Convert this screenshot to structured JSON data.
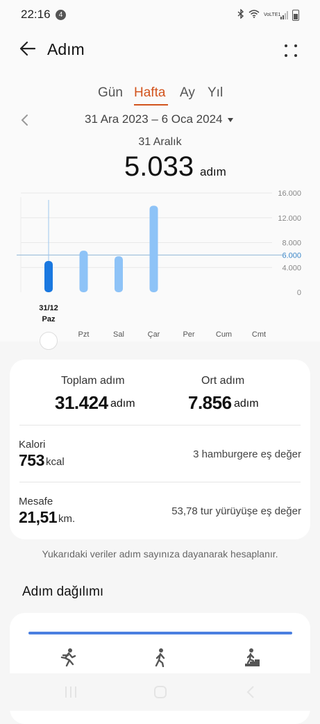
{
  "status": {
    "time": "22:16",
    "notif_count": "4",
    "net_label": "VoLTE1"
  },
  "header": {
    "title": "Adım"
  },
  "tabs": [
    {
      "label": "Gün",
      "active": false
    },
    {
      "label": "Hafta",
      "active": true
    },
    {
      "label": "Ay",
      "active": false
    },
    {
      "label": "Yıl",
      "active": false
    }
  ],
  "date_range": "31 Ara 2023 – 6 Oca 2024",
  "selected": {
    "day": "31 Aralık",
    "value": "5.033",
    "unit": "adım"
  },
  "chart_data": {
    "type": "bar",
    "categories": [
      "Paz",
      "Pzt",
      "Sal",
      "Çar",
      "Per",
      "Cum",
      "Cmt"
    ],
    "selected_date_label": "31/12",
    "values": [
      5033,
      6700,
      5800,
      13950,
      0,
      0,
      0
    ],
    "ylim": [
      0,
      16000
    ],
    "yticks": [
      "16.000",
      "12.000",
      "8.000",
      "6.000",
      "4.000",
      "0"
    ],
    "ytick_values": [
      16000,
      12000,
      8000,
      6000,
      4000,
      0
    ],
    "goal_value": 6000,
    "goal_label": "6.000",
    "selected_index": 0,
    "colors": {
      "bar": "#8ec3f7",
      "selected_bar": "#1a78e0",
      "goal_line": "#8fb6d6",
      "goal_text": "#3a86c8"
    }
  },
  "summary": {
    "total_label": "Toplam adım",
    "total_value": "31.424",
    "total_unit": "adım",
    "avg_label": "Ort adım",
    "avg_value": "7.856",
    "avg_unit": "adım",
    "calorie_label": "Kalori",
    "calorie_value": "753",
    "calorie_unit": "kcal",
    "calorie_equiv": "3 hamburgere eş değer",
    "distance_label": "Mesafe",
    "distance_value": "21,51",
    "distance_unit": "km.",
    "distance_equiv": "53,78 tur yürüyüşe eş değer"
  },
  "note": "Yukarıdaki veriler adım sayınıza dayanarak hesaplanır.",
  "distribution": {
    "title": "Adım dağılımı",
    "icons": [
      "running-icon",
      "walking-icon",
      "climbing-stairs-icon"
    ],
    "bar_color": "#4a7fe0"
  }
}
